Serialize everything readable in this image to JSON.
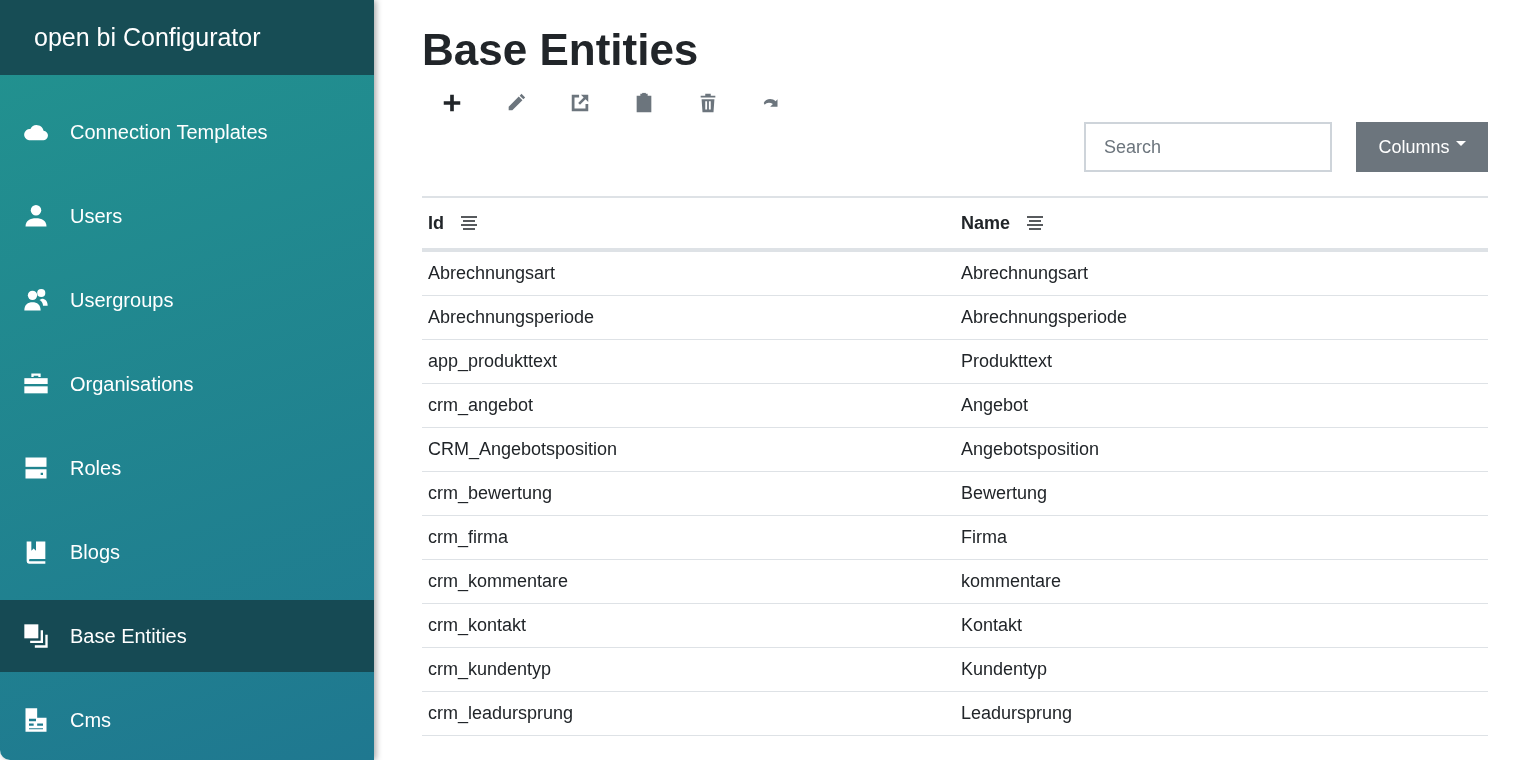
{
  "sidebar": {
    "title": "open bi Configurator",
    "items": [
      {
        "label": "Connection Templates",
        "selected": false
      },
      {
        "label": "Users",
        "selected": false
      },
      {
        "label": "Usergroups",
        "selected": false
      },
      {
        "label": "Organisations",
        "selected": false
      },
      {
        "label": "Roles",
        "selected": false
      },
      {
        "label": "Blogs",
        "selected": false
      },
      {
        "label": "Base Entities",
        "selected": true
      },
      {
        "label": "Cms",
        "selected": false
      }
    ]
  },
  "page": {
    "title": "Base Entities"
  },
  "toolbar": [
    {
      "disabled": false
    },
    {
      "disabled": true
    },
    {
      "disabled": true
    },
    {
      "disabled": true
    },
    {
      "disabled": true
    },
    {
      "disabled": true
    }
  ],
  "search": {
    "placeholder": "Search"
  },
  "columns_button": {
    "label": "Columns"
  },
  "table": {
    "columns": [
      "Id",
      "Name"
    ],
    "rows": [
      [
        "Abrechnungsart",
        "Abrechnungsart"
      ],
      [
        "Abrechnungsperiode",
        "Abrechnungsperiode"
      ],
      [
        "app_produkttext",
        "Produkttext"
      ],
      [
        "crm_angebot",
        "Angebot"
      ],
      [
        "CRM_Angebotsposition",
        "Angebotsposition"
      ],
      [
        "crm_bewertung",
        "Bewertung"
      ],
      [
        "crm_firma",
        "Firma"
      ],
      [
        "crm_kommentare",
        "kommentare"
      ],
      [
        "crm_kontakt",
        "Kontakt"
      ],
      [
        "crm_kundentyp",
        "Kundentyp"
      ],
      [
        "crm_leadursprung",
        "Leadursprung"
      ]
    ]
  }
}
